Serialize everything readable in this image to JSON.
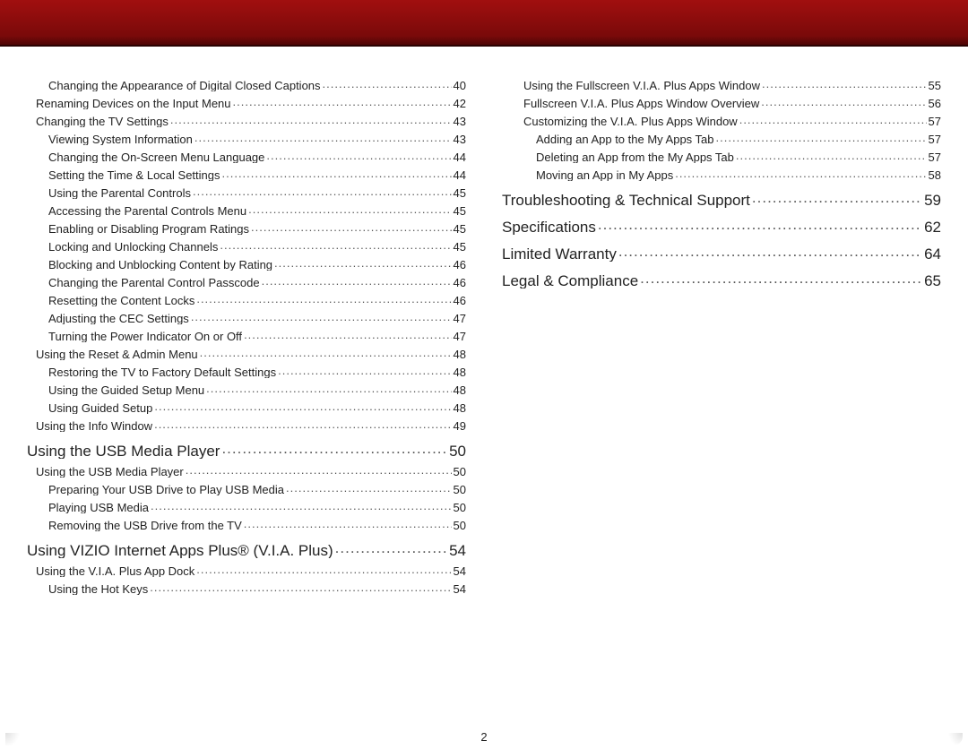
{
  "page_number": "2",
  "columns": {
    "left": [
      {
        "level": "lvl-1",
        "label": "Changing the Appearance of Digital Closed Captions",
        "page": "40"
      },
      {
        "level": "lvl-0",
        "label": "Renaming Devices on the Input Menu",
        "page": "42"
      },
      {
        "level": "lvl-0",
        "label": "Changing the TV Settings",
        "page": "43"
      },
      {
        "level": "lvl-1",
        "label": "Viewing System Information",
        "page": "43"
      },
      {
        "level": "lvl-1",
        "label": "Changing the On-Screen Menu Language",
        "page": "44"
      },
      {
        "level": "lvl-1",
        "label": "Setting the Time & Local Settings",
        "page": "44"
      },
      {
        "level": "lvl-1",
        "label": "Using the Parental Controls",
        "page": "45"
      },
      {
        "level": "lvl-1",
        "label": "Accessing the Parental Controls Menu",
        "page": "45"
      },
      {
        "level": "lvl-1",
        "label": "Enabling or Disabling Program Ratings",
        "page": "45"
      },
      {
        "level": "lvl-1",
        "label": "Locking and Unlocking Channels",
        "page": "45"
      },
      {
        "level": "lvl-1",
        "label": "Blocking and Unblocking Content by Rating",
        "page": "46"
      },
      {
        "level": "lvl-1",
        "label": "Changing the Parental Control Passcode",
        "page": "46"
      },
      {
        "level": "lvl-1",
        "label": "Resetting the Content Locks",
        "page": "46"
      },
      {
        "level": "lvl-1",
        "label": "Adjusting the CEC Settings",
        "page": "47"
      },
      {
        "level": "lvl-1",
        "label": "Turning the Power Indicator On or Off",
        "page": "47"
      },
      {
        "level": "lvl-0",
        "label": "Using the Reset & Admin Menu",
        "page": "48"
      },
      {
        "level": "lvl-1",
        "label": "Restoring the TV to Factory Default Settings",
        "page": "48"
      },
      {
        "level": "lvl-1",
        "label": "Using the Guided Setup Menu",
        "page": "48"
      },
      {
        "level": "lvl-1",
        "label": "Using Guided Setup",
        "page": "48"
      },
      {
        "level": "lvl-0",
        "label": "Using the Info Window",
        "page": "49"
      },
      {
        "level": "lvl-section",
        "label": "Using the USB Media Player",
        "page": "50"
      },
      {
        "level": "lvl-0",
        "label": "Using the USB Media Player",
        "page": "50"
      },
      {
        "level": "lvl-1",
        "label": "Preparing Your USB Drive to Play USB Media",
        "page": "50"
      },
      {
        "level": "lvl-1",
        "label": "Playing USB Media",
        "page": "50"
      },
      {
        "level": "lvl-1",
        "label": "Removing the USB Drive from the TV",
        "page": "50"
      },
      {
        "level": "lvl-section",
        "label": "Using VIZIO Internet Apps Plus® (V.I.A. Plus)",
        "page": "54",
        "registered_after": "Plus"
      },
      {
        "level": "lvl-0",
        "label": "Using the V.I.A. Plus App Dock",
        "page": "54"
      },
      {
        "level": "lvl-1",
        "label": "Using the Hot Keys",
        "page": "54"
      }
    ],
    "right": [
      {
        "level": "lvl-1",
        "label": "Using the Fullscreen V.I.A. Plus Apps Window",
        "page": "55"
      },
      {
        "level": "lvl-1",
        "label": "Fullscreen V.I.A. Plus Apps Window Overview",
        "page": "56"
      },
      {
        "level": "lvl-1",
        "label": "Customizing the V.I.A. Plus Apps Window",
        "page": "57"
      },
      {
        "level": "lvl-2",
        "label": "Adding an App to the My Apps Tab",
        "page": "57"
      },
      {
        "level": "lvl-2",
        "label": "Deleting an App from the My Apps Tab",
        "page": "57"
      },
      {
        "level": "lvl-2",
        "label": "Moving an App in My Apps",
        "page": "58"
      },
      {
        "level": "lvl-section",
        "label": "Troubleshooting & Technical Support",
        "page": "59"
      },
      {
        "level": "lvl-section",
        "label": "Specifications",
        "page": "62"
      },
      {
        "level": "lvl-section",
        "label": "Limited Warranty",
        "page": "64"
      },
      {
        "level": "lvl-section",
        "label": "Legal & Compliance",
        "page": "65"
      }
    ]
  }
}
